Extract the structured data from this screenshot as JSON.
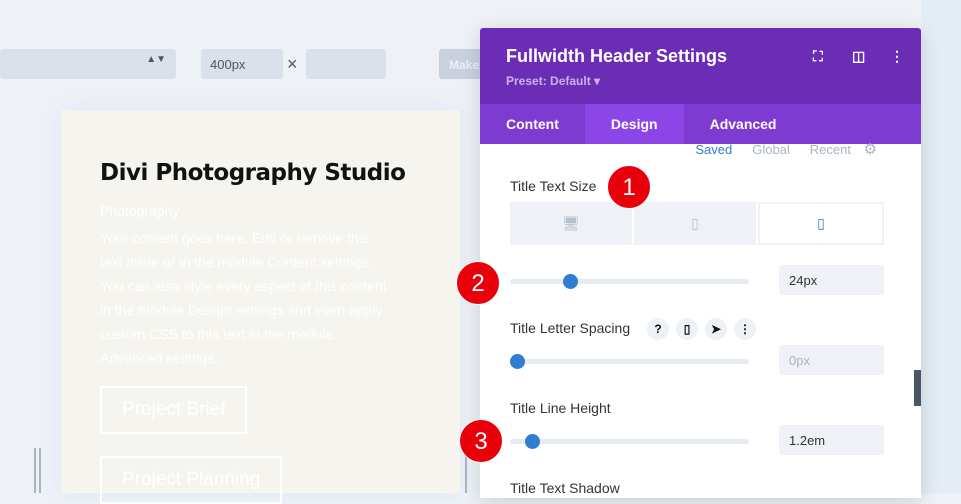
{
  "toolbar": {
    "width_value": "400px",
    "times": "×",
    "make_label": "Make",
    "select_arrow": "▲▼"
  },
  "card": {
    "title": "Divi Photography Studio",
    "subtitle": "Photography",
    "body": "Your content goes here. Edit or remove this text inline or in the module Content settings. You can also style every aspect of this content in the module Design settings and even apply custom CSS to this text in the module Advanced settings.",
    "buttons": [
      "Project Brief",
      "Project Planning"
    ]
  },
  "panel": {
    "title": "Fullwidth Header Settings",
    "preset": "Preset: Default ▾",
    "tabs": [
      "Content",
      "Design",
      "Advanced"
    ],
    "presets": [
      "Saved",
      "Global",
      "Recent"
    ],
    "fields": [
      {
        "label": "Title Text Size",
        "value": "24px",
        "percent": 25
      },
      {
        "label": "Title Letter Spacing",
        "value": "0px",
        "percent": 0
      },
      {
        "label": "Title Line Height",
        "value": "1.2em",
        "percent": 9
      },
      {
        "label": "Title Text Shadow"
      }
    ]
  },
  "badges": [
    "1",
    "2",
    "3"
  ],
  "colors": {
    "header": "#6b2db5",
    "tabs": "#7d3bd1",
    "active_tab": "#8c46e8",
    "accent": "#2e7ed1",
    "badge": "#e8000b"
  }
}
